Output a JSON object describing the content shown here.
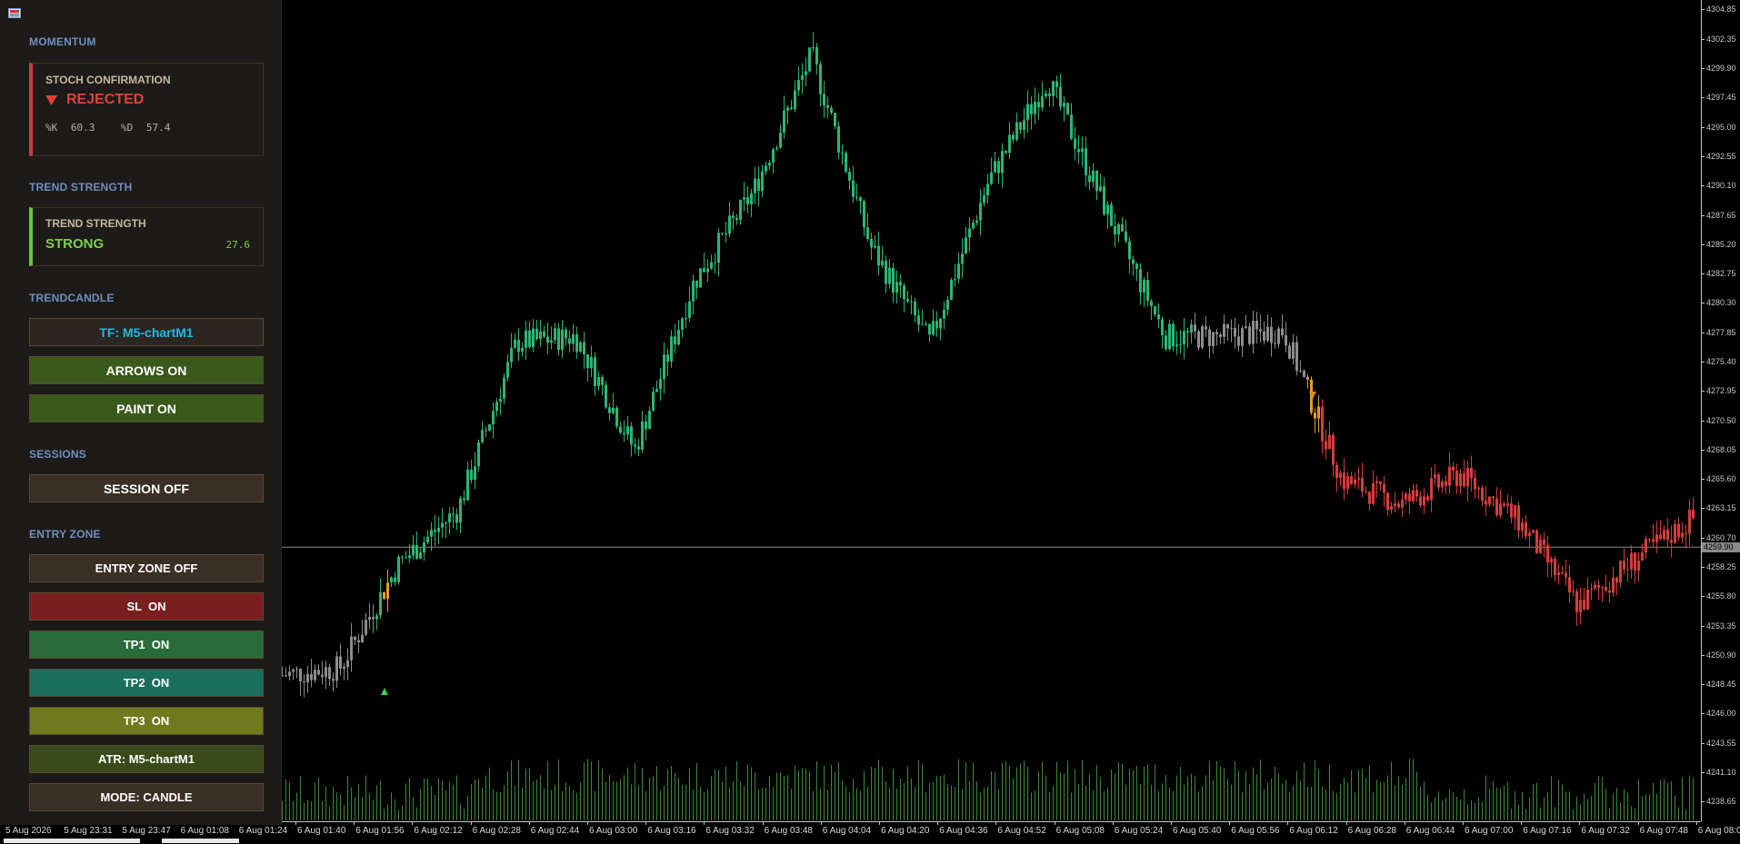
{
  "colors": {
    "background": "#000000",
    "panel_bg": "#1d1b19",
    "section_title": "#6f8fc0",
    "bull_candle": "#2bb673",
    "bear_candle": "#d63c3c",
    "neutral_candle": "#8c8c8c",
    "volume": "#3a8a3a",
    "rejected": "#e0403a",
    "strong": "#7cd04a",
    "tf_text": "#22b8e6"
  },
  "panel": {
    "momentum": {
      "title": "MOMENTUM",
      "card_label": "STOCH CONFIRMATION",
      "status_icon": "triangle-down-icon",
      "status_text": "REJECTED",
      "k_label": "%K",
      "k_value": "60.3",
      "d_label": "%D",
      "d_value": "57.4"
    },
    "trend": {
      "title": "TREND STRENGTH",
      "card_label": "TREND STRENGTH",
      "status": "STRONG",
      "value": "27.6"
    },
    "trendcandle": {
      "title": "TRENDCANDLE",
      "tf_button": "TF: M5-chartM1",
      "arrows_button": "ARROWS ON",
      "paint_button": "PAINT ON"
    },
    "sessions": {
      "title": "SESSIONS",
      "session_button": "SESSION OFF"
    },
    "entry": {
      "title": "ENTRY ZONE",
      "entry_button": "ENTRY ZONE OFF",
      "sl_button": "SL  ON",
      "tp1_button": "TP1  ON",
      "tp2_button": "TP2  ON",
      "tp3_button": "TP3  ON",
      "atr_button": "ATR: M5-chartM1",
      "mode_button": "MODE: CANDLE"
    }
  },
  "price_axis": {
    "labels": [
      "4304.85",
      "4302.35",
      "4299.90",
      "4297.45",
      "4295.00",
      "4292.55",
      "4290.10",
      "4287.65",
      "4285.20",
      "4282.75",
      "4280.30",
      "4277.85",
      "4275.40",
      "4272.95",
      "4270.50",
      "4268.05",
      "4265.60",
      "4263.15",
      "4260.70",
      "4258.25",
      "4255.80",
      "4253.35",
      "4250.90",
      "4248.45",
      "4246.00",
      "4243.55",
      "4241.10",
      "4238.65"
    ],
    "current_price": "4259.90"
  },
  "time_axis": {
    "labels": [
      "5 Aug 2026",
      "5 Aug 23:31",
      "5 Aug 23:47",
      "6 Aug 01:08",
      "6 Aug 01:24",
      "6 Aug 01:40",
      "6 Aug 01:56",
      "6 Aug 02:12",
      "6 Aug 02:28",
      "6 Aug 02:44",
      "6 Aug 03:00",
      "6 Aug 03:16",
      "6 Aug 03:32",
      "6 Aug 03:48",
      "6 Aug 04:04",
      "6 Aug 04:20",
      "6 Aug 04:36",
      "6 Aug 04:52",
      "6 Aug 05:08",
      "6 Aug 05:24",
      "6 Aug 05:40",
      "6 Aug 05:56",
      "6 Aug 06:12",
      "6 Aug 06:28",
      "6 Aug 06:44",
      "6 Aug 07:00",
      "6 Aug 07:16",
      "6 Aug 07:32",
      "6 Aug 07:48",
      "6 Aug 08:0"
    ]
  },
  "chart_data": {
    "type": "line",
    "title": "",
    "xlabel": "",
    "ylabel": "",
    "ylim": [
      4237.0,
      4305.6
    ],
    "x": [
      "6 Aug 01:40",
      "6 Aug 01:56",
      "6 Aug 02:12",
      "6 Aug 02:28",
      "6 Aug 02:44",
      "6 Aug 03:00",
      "6 Aug 03:16",
      "6 Aug 03:32",
      "6 Aug 03:48",
      "6 Aug 04:04",
      "6 Aug 04:20",
      "6 Aug 04:36",
      "6 Aug 04:52",
      "6 Aug 05:08",
      "6 Aug 05:24",
      "6 Aug 05:40",
      "6 Aug 05:56",
      "6 Aug 06:12",
      "6 Aug 06:28",
      "6 Aug 06:44",
      "6 Aug 07:00",
      "6 Aug 07:16",
      "6 Aug 07:32",
      "6 Aug 07:48",
      "6 Aug 08:0"
    ],
    "series": [
      {
        "values": [
          4249.2,
          4249.8,
          4258.5,
          4263.0,
          4277.0,
          4277.5,
          4268.0,
          4282.0,
          4289.5,
          4301.0,
          4285.0,
          4277.0,
          4290.5,
          4299.0,
          4288.0,
          4277.5,
          4277.5,
          4278.0,
          4265.5,
          4263.5,
          4266.0,
          4262.0,
          4255.0,
          4259.0,
          4262.5
        ]
      }
    ],
    "reference_line": 4259.9,
    "signal_up_arrow": "6 Aug 01:56",
    "signal_down_arrow": "6 Aug 06:12",
    "volume_panel": true,
    "grid": false
  }
}
